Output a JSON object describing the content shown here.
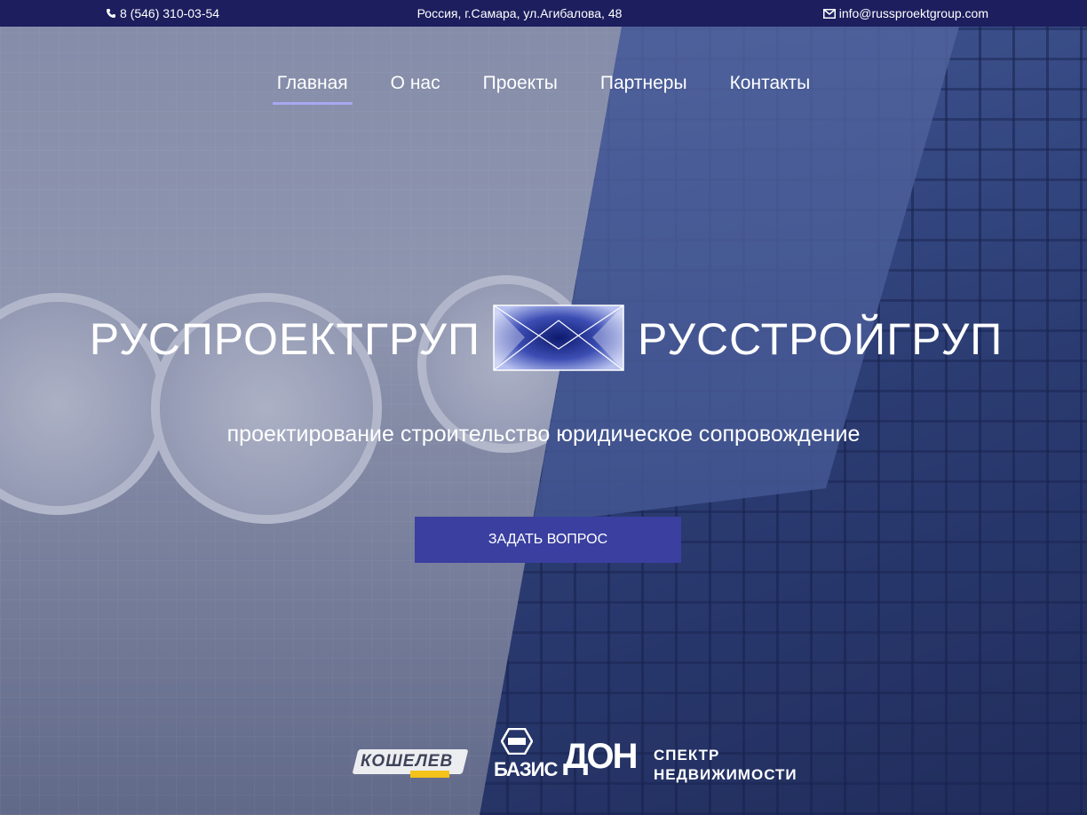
{
  "topbar": {
    "phone": "8 (546) 310-03-54",
    "address": "Россия, г.Самара, ул.Агибалова, 48",
    "email": "info@russproektgroup.com",
    "phone_icon": "phone-icon",
    "email_icon": "envelope-icon"
  },
  "nav": {
    "items": [
      {
        "label": "Главная",
        "active": true
      },
      {
        "label": "О нас"
      },
      {
        "label": "Проекты"
      },
      {
        "label": "Партнеры"
      },
      {
        "label": "Контакты"
      }
    ]
  },
  "hero": {
    "brand_left": "РУСПРОЕКТГРУП",
    "brand_right": "РУССТРОЙГРУП",
    "tagline": "проектирование строительство юридическое сопровождение",
    "cta_label": "ЗАДАТЬ ВОПРОС"
  },
  "partners": {
    "koshelev": "КОШЕЛЕВ",
    "basis": "БАЗИС",
    "don": "ДОН",
    "spektr_line1": "СПЕКТР",
    "spektr_line2": "НЕДВИЖИМОСТИ"
  },
  "colors": {
    "topbar_bg": "#1c1e5e",
    "accent": "#3a3fa0",
    "nav_underline": "#a9a6f2"
  }
}
